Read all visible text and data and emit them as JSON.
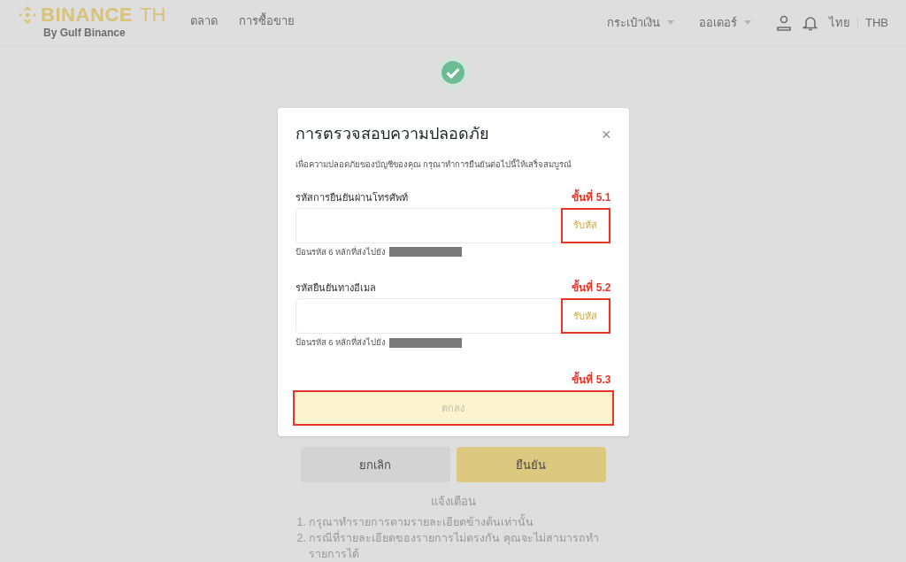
{
  "header": {
    "logo": {
      "brand": "BINANCE",
      "suffix": "TH",
      "tagline": "By Gulf Binance"
    },
    "nav": [
      {
        "label": "ตลาด"
      },
      {
        "label": "การซื้อขาย"
      }
    ],
    "menus": [
      {
        "label": "กระเป๋าเงิน"
      },
      {
        "label": "ออเดอร์"
      }
    ],
    "language": "ไทย",
    "currency": "THB"
  },
  "dialog": {
    "title": "การตรวจสอบความปลอดภัย",
    "close": "×",
    "description": "เพื่อความปลอดภัยของบัญชีของคุณ กรุณาทำการยืนยันต่อไปนี้ให้เสร็จสมบูรณ์",
    "fields": [
      {
        "label": "รหัสการยืนยันผ่านโทรศัพท์",
        "step": "ขั้นที่ 5.1",
        "button": "รับหัส",
        "hint": "ป้อนรหัส 6 หลักที่ส่งไปยัง"
      },
      {
        "label": "รหัสยืนยันทางอีเมล",
        "step": "ขั้นที่ 5.2",
        "button": "รับหัส",
        "hint": "ป้อนรหัส 6 หลักที่ส่งไปยัง"
      }
    ],
    "submit": {
      "step": "ขั้นที่ 5.3",
      "label": "ตกลง",
      "disabled": true
    }
  },
  "actions": [
    {
      "label": "ยกเลิก",
      "kind": "secondary"
    },
    {
      "label": "ยืนยัน",
      "kind": "primary"
    }
  ],
  "notice": {
    "title": "แจ้งเตือน",
    "items": [
      "1. กรุณาทำรายการตามรายละเอียดข้างต้นเท่านั้น",
      "2. กรณีที่รายละเอียดของรายการไม่ตรงกัน คุณจะไม่สามารถทำรายการได้"
    ]
  }
}
